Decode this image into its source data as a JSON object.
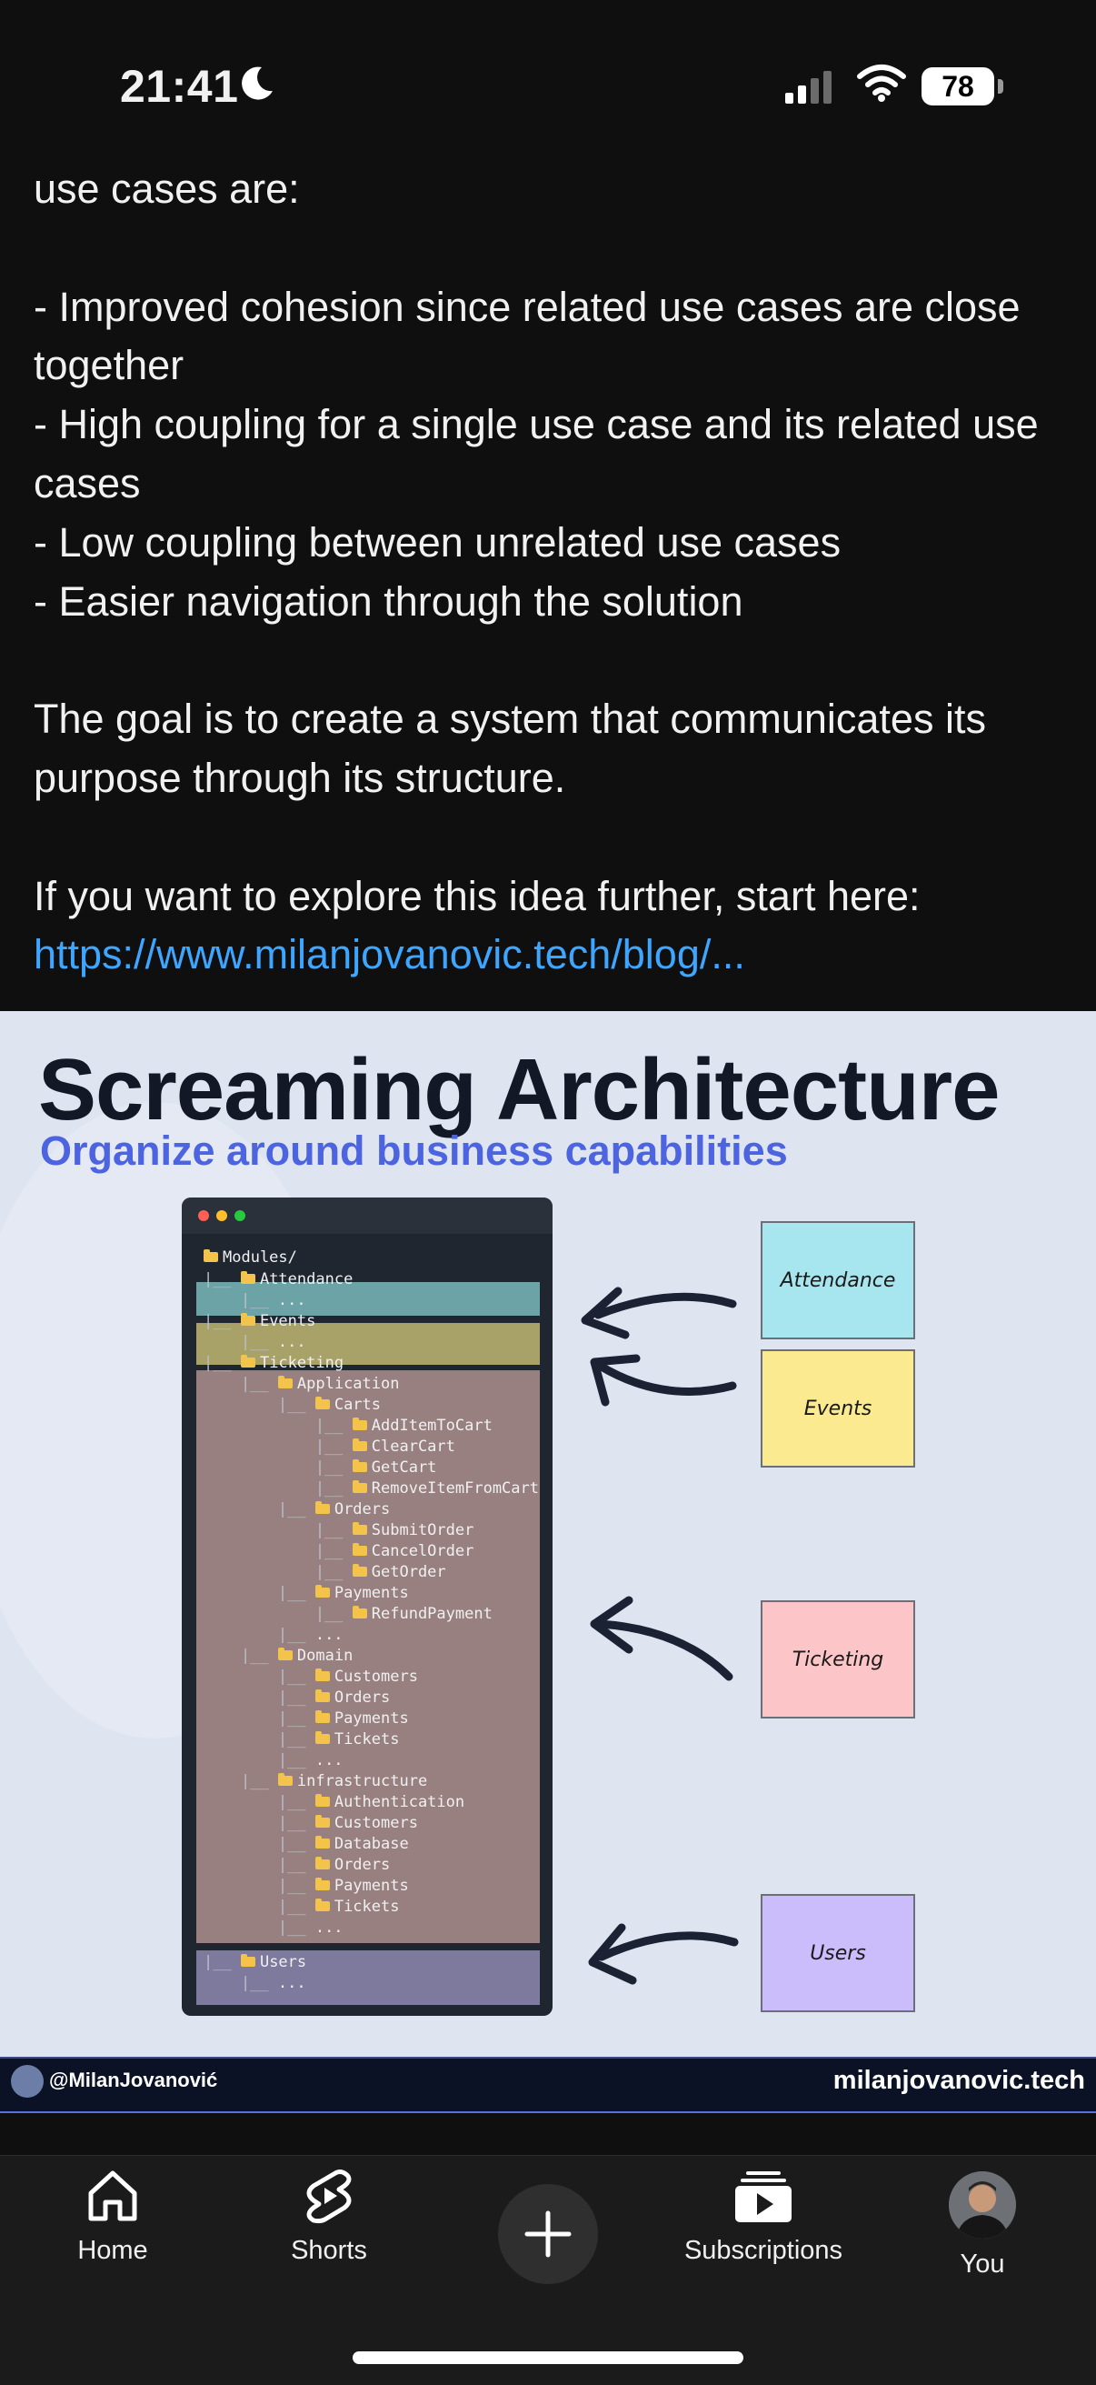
{
  "status_bar": {
    "time": "21:41",
    "battery": "78"
  },
  "description": {
    "lines": [
      "use cases are:",
      "",
      "- Improved cohesion since related use cases are close together",
      "- High coupling for a single use case and its related use cases",
      "- Low coupling between unrelated use cases",
      "- Easier navigation through the solution",
      "",
      "The goal is to create a system that communicates its purpose through its structure.",
      "",
      "If you want to explore this idea further, start here:"
    ],
    "link": "https://www.milanjovanovic.tech/blog/..."
  },
  "thumbnail": {
    "title": "Screaming Architecture",
    "subtitle": "Organize around business capabilities",
    "tree": [
      {
        "pipes": "",
        "name": "Modules/",
        "folder": true
      },
      {
        "pipes": "|__ ",
        "name": "Attendance",
        "folder": true
      },
      {
        "pipes": "    |__ ",
        "name": "...",
        "folder": false
      },
      {
        "pipes": "|__ ",
        "name": "Events",
        "folder": true
      },
      {
        "pipes": "    |__ ",
        "name": "...",
        "folder": false
      },
      {
        "pipes": "|__ ",
        "name": "Ticketing",
        "folder": true
      },
      {
        "pipes": "    |__ ",
        "name": "Application",
        "folder": true
      },
      {
        "pipes": "        |__ ",
        "name": "Carts",
        "folder": true
      },
      {
        "pipes": "            |__ ",
        "name": "AddItemToCart",
        "folder": true
      },
      {
        "pipes": "            |__ ",
        "name": "ClearCart",
        "folder": true
      },
      {
        "pipes": "            |__ ",
        "name": "GetCart",
        "folder": true
      },
      {
        "pipes": "            |__ ",
        "name": "RemoveItemFromCart",
        "folder": true
      },
      {
        "pipes": "        |__ ",
        "name": "Orders",
        "folder": true
      },
      {
        "pipes": "            |__ ",
        "name": "SubmitOrder",
        "folder": true
      },
      {
        "pipes": "            |__ ",
        "name": "CancelOrder",
        "folder": true
      },
      {
        "pipes": "            |__ ",
        "name": "GetOrder",
        "folder": true
      },
      {
        "pipes": "        |__ ",
        "name": "Payments",
        "folder": true
      },
      {
        "pipes": "            |__ ",
        "name": "RefundPayment",
        "folder": true
      },
      {
        "pipes": "        |__ ",
        "name": "...",
        "folder": false
      },
      {
        "pipes": "    |__ ",
        "name": "Domain",
        "folder": true
      },
      {
        "pipes": "        |__ ",
        "name": "Customers",
        "folder": true
      },
      {
        "pipes": "        |__ ",
        "name": "Orders",
        "folder": true
      },
      {
        "pipes": "        |__ ",
        "name": "Payments",
        "folder": true
      },
      {
        "pipes": "        |__ ",
        "name": "Tickets",
        "folder": true
      },
      {
        "pipes": "        |__ ",
        "name": "...",
        "folder": false
      },
      {
        "pipes": "    |__ ",
        "name": "infrastructure",
        "folder": true
      },
      {
        "pipes": "        |__ ",
        "name": "Authentication",
        "folder": true
      },
      {
        "pipes": "        |__ ",
        "name": "Customers",
        "folder": true
      },
      {
        "pipes": "        |__ ",
        "name": "Database",
        "folder": true
      },
      {
        "pipes": "        |__ ",
        "name": "Orders",
        "folder": true
      },
      {
        "pipes": "        |__ ",
        "name": "Payments",
        "folder": true
      },
      {
        "pipes": "        |__ ",
        "name": "Tickets",
        "folder": true
      },
      {
        "pipes": "        |__ ",
        "name": "...",
        "folder": false
      },
      {
        "pipes": "|__ ",
        "name": "Users",
        "folder": true
      },
      {
        "pipes": "    |__ ",
        "name": "...",
        "folder": false
      }
    ],
    "cards": {
      "attendance": "Attendance",
      "events": "Events",
      "ticketing": "Ticketing",
      "users": "Users"
    },
    "colors": {
      "attendance": "#a8e6ef",
      "events": "#fbea90",
      "ticketing": "#fcc6c9",
      "users": "#cbbdfb",
      "attendance_hl": "#6ca3a6",
      "events_hl": "#a8a269",
      "ticketing_hl": "#97807f",
      "users_hl": "#7d7a9e"
    },
    "channel_handle": "@MilanJovanović",
    "channel_site": "milanjovanovic.tech"
  },
  "nav": {
    "home": "Home",
    "shorts": "Shorts",
    "subscriptions": "Subscriptions",
    "you": "You"
  }
}
